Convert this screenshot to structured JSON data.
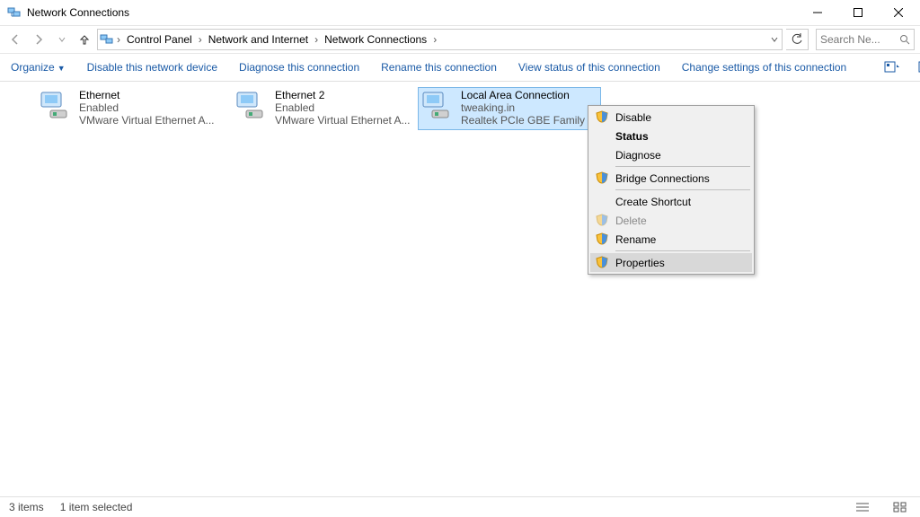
{
  "title": "Network Connections",
  "breadcrumb": [
    "Control Panel",
    "Network and Internet",
    "Network Connections"
  ],
  "search_placeholder": "Search Ne...",
  "commands": {
    "organize": "Organize",
    "disable": "Disable this network device",
    "diagnose": "Diagnose this connection",
    "rename": "Rename this connection",
    "view_status": "View status of this connection",
    "change_settings": "Change settings of this connection"
  },
  "connections": [
    {
      "name": "Ethernet",
      "status": "Enabled",
      "device": "VMware Virtual Ethernet A..."
    },
    {
      "name": "Ethernet 2",
      "status": "Enabled",
      "device": "VMware Virtual Ethernet A..."
    },
    {
      "name": "Local Area Connection",
      "status": "tweaking.in",
      "device": "Realtek PCIe GBE Family C..."
    }
  ],
  "context_menu": {
    "disable": "Disable",
    "status": "Status",
    "diagnose": "Diagnose",
    "bridge": "Bridge Connections",
    "shortcut": "Create Shortcut",
    "delete": "Delete",
    "rename": "Rename",
    "properties": "Properties"
  },
  "statusbar": {
    "count": "3 items",
    "selected": "1 item selected"
  }
}
